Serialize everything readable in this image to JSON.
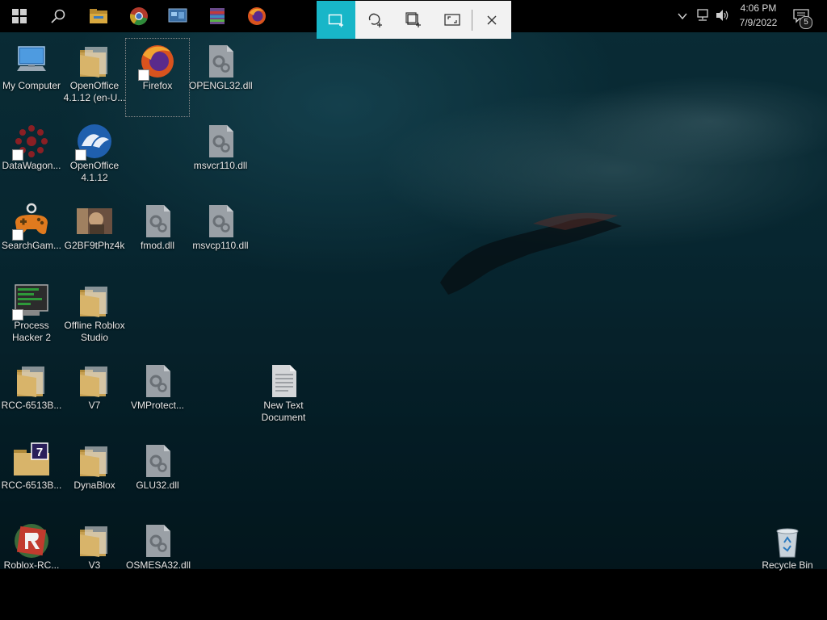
{
  "taskbar": {
    "pinned": [
      {
        "name": "windows-start-icon"
      },
      {
        "name": "search-icon"
      },
      {
        "name": "file-explorer-icon"
      },
      {
        "name": "chrome-icon"
      },
      {
        "name": "control-panel-icon"
      },
      {
        "name": "winrar-icon"
      },
      {
        "name": "firefox-icon"
      }
    ],
    "time": "4:06 PM",
    "date": "7/9/2022",
    "notification_count": "5"
  },
  "snip_toolbar": {
    "modes": [
      "rectangular-snip",
      "freeform-snip",
      "window-snip",
      "fullscreen-snip"
    ],
    "active": "rectangular-snip"
  },
  "desktop": {
    "icons": [
      {
        "label": "My Computer",
        "kind": "computer"
      },
      {
        "label": "OpenOffice 4.1.12 (en-U...",
        "kind": "folder"
      },
      {
        "label": "Firefox",
        "kind": "firefox",
        "selected": true
      },
      {
        "label": "OPENGL32.dll",
        "kind": "dll"
      },
      {
        "label": "DataWagon...",
        "kind": "datawagon"
      },
      {
        "label": "OpenOffice 4.1.12",
        "kind": "openoffice"
      },
      {
        "label": "msvcr110.dll",
        "kind": "dll"
      },
      {
        "label": "SearchGam...",
        "kind": "gamepad"
      },
      {
        "label": "G2BF9tPhz4k",
        "kind": "image"
      },
      {
        "label": "fmod.dll",
        "kind": "dll"
      },
      {
        "label": "msvcp110.dll",
        "kind": "dll"
      },
      {
        "label": "Process Hacker 2",
        "kind": "processhacker"
      },
      {
        "label": "Offline Roblox Studio",
        "kind": "folder"
      },
      {
        "label": "RCC-6513B...",
        "kind": "folder"
      },
      {
        "label": "V7",
        "kind": "folder"
      },
      {
        "label": "VMProtect...",
        "kind": "dll"
      },
      {
        "label": "New Text Document",
        "kind": "text"
      },
      {
        "label": "RCC-6513B...",
        "kind": "folder7"
      },
      {
        "label": "DynaBlox",
        "kind": "folder"
      },
      {
        "label": "GLU32.dll",
        "kind": "dll"
      },
      {
        "label": "Roblox-RC...",
        "kind": "roblox"
      },
      {
        "label": "V3",
        "kind": "folder"
      },
      {
        "label": "OSMESA32.dll",
        "kind": "dll"
      },
      {
        "label": "Recycle Bin",
        "kind": "recycle"
      }
    ]
  }
}
